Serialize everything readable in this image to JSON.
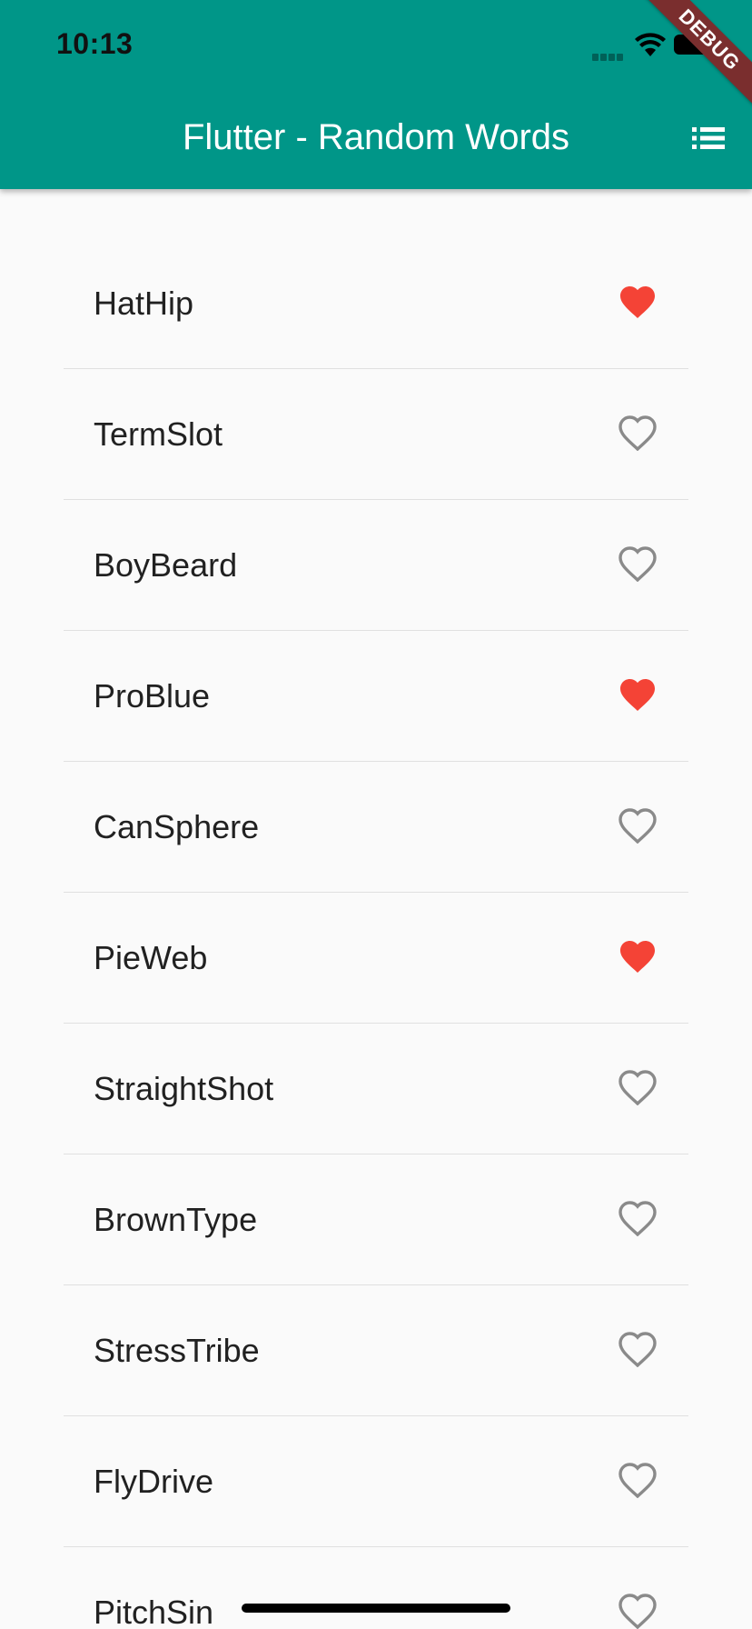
{
  "status_bar": {
    "time": "10:13"
  },
  "debug_banner": "DEBUG",
  "app_bar": {
    "title": "Flutter - Random Words",
    "menu_icon": "list-icon",
    "background": "#009688"
  },
  "colors": {
    "favorite": "#f44336",
    "not_favorite": "#8a8a8a"
  },
  "words": [
    {
      "label": "HatHip",
      "favorite": true
    },
    {
      "label": "TermSlot",
      "favorite": false
    },
    {
      "label": "BoyBeard",
      "favorite": false
    },
    {
      "label": "ProBlue",
      "favorite": true
    },
    {
      "label": "CanSphere",
      "favorite": false
    },
    {
      "label": "PieWeb",
      "favorite": true
    },
    {
      "label": "StraightShot",
      "favorite": false
    },
    {
      "label": "BrownType",
      "favorite": false
    },
    {
      "label": "StressTribe",
      "favorite": false
    },
    {
      "label": "FlyDrive",
      "favorite": false
    },
    {
      "label": "PitchSin",
      "favorite": false
    }
  ]
}
